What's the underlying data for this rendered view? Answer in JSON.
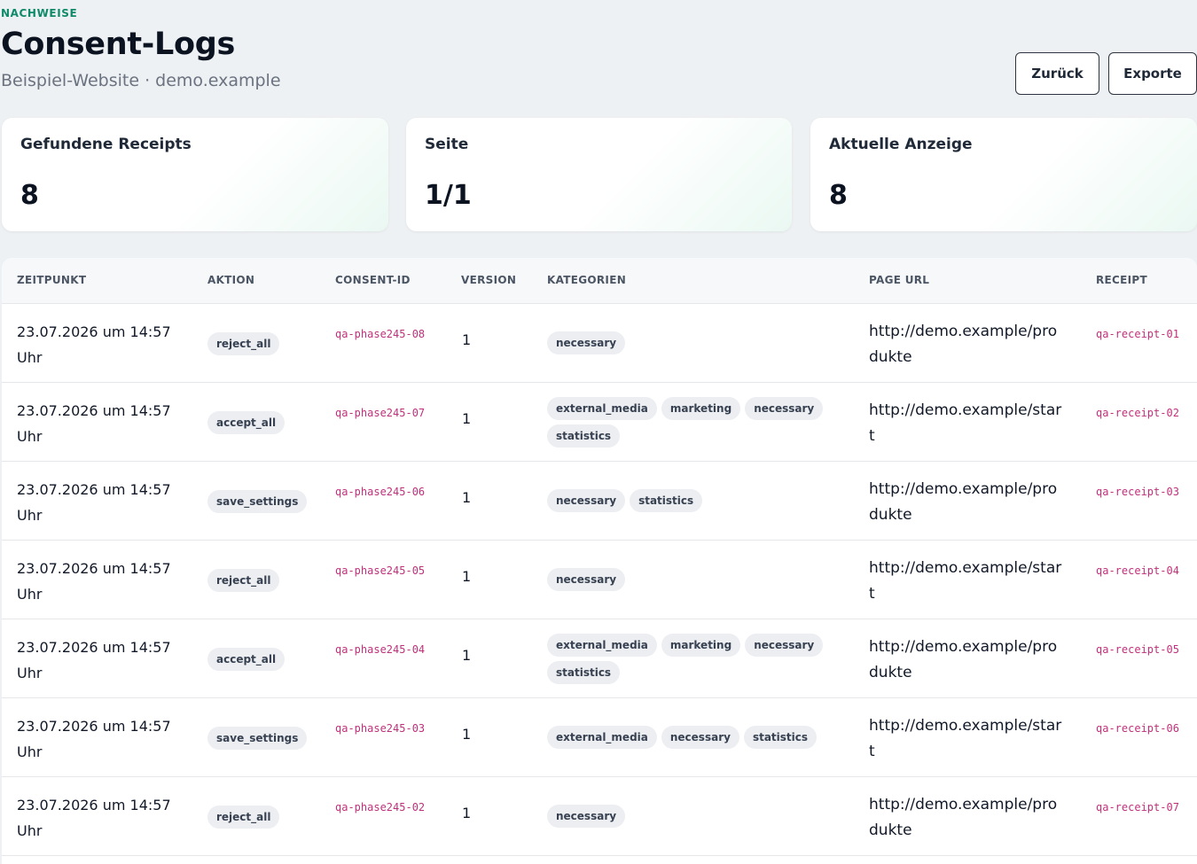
{
  "header": {
    "eyebrow": "NACHWEISE",
    "title": "Consent-Logs",
    "subtitle": "Beispiel-Website · demo.example",
    "back_label": "Zurück",
    "export_label": "Exporte"
  },
  "stats": [
    {
      "label": "Gefundene Receipts",
      "value": "8"
    },
    {
      "label": "Seite",
      "value": "1/1"
    },
    {
      "label": "Aktuelle Anzeige",
      "value": "8"
    }
  ],
  "table": {
    "columns": [
      "ZEITPUNKT",
      "AKTION",
      "CONSENT-ID",
      "VERSION",
      "KATEGORIEN",
      "PAGE URL",
      "RECEIPT"
    ],
    "rows": [
      {
        "time": "23.07.2026 um 14:57 Uhr",
        "action": "reject_all",
        "consent_id": "qa-phase245-08",
        "version": "1",
        "categories": [
          "necessary"
        ],
        "url": "http://demo.example/produkte",
        "receipt": "qa-receipt-01"
      },
      {
        "time": "23.07.2026 um 14:57 Uhr",
        "action": "accept_all",
        "consent_id": "qa-phase245-07",
        "version": "1",
        "categories": [
          "external_media",
          "marketing",
          "necessary",
          "statistics"
        ],
        "url": "http://demo.example/start",
        "receipt": "qa-receipt-02"
      },
      {
        "time": "23.07.2026 um 14:57 Uhr",
        "action": "save_settings",
        "consent_id": "qa-phase245-06",
        "version": "1",
        "categories": [
          "necessary",
          "statistics"
        ],
        "url": "http://demo.example/produkte",
        "receipt": "qa-receipt-03"
      },
      {
        "time": "23.07.2026 um 14:57 Uhr",
        "action": "reject_all",
        "consent_id": "qa-phase245-05",
        "version": "1",
        "categories": [
          "necessary"
        ],
        "url": "http://demo.example/start",
        "receipt": "qa-receipt-04"
      },
      {
        "time": "23.07.2026 um 14:57 Uhr",
        "action": "accept_all",
        "consent_id": "qa-phase245-04",
        "version": "1",
        "categories": [
          "external_media",
          "marketing",
          "necessary",
          "statistics"
        ],
        "url": "http://demo.example/produkte",
        "receipt": "qa-receipt-05"
      },
      {
        "time": "23.07.2026 um 14:57 Uhr",
        "action": "save_settings",
        "consent_id": "qa-phase245-03",
        "version": "1",
        "categories": [
          "external_media",
          "necessary",
          "statistics"
        ],
        "url": "http://demo.example/start",
        "receipt": "qa-receipt-06"
      },
      {
        "time": "23.07.2026 um 14:57 Uhr",
        "action": "reject_all",
        "consent_id": "qa-phase245-02",
        "version": "1",
        "categories": [
          "necessary"
        ],
        "url": "http://demo.example/produkte",
        "receipt": "qa-receipt-07"
      }
    ]
  }
}
